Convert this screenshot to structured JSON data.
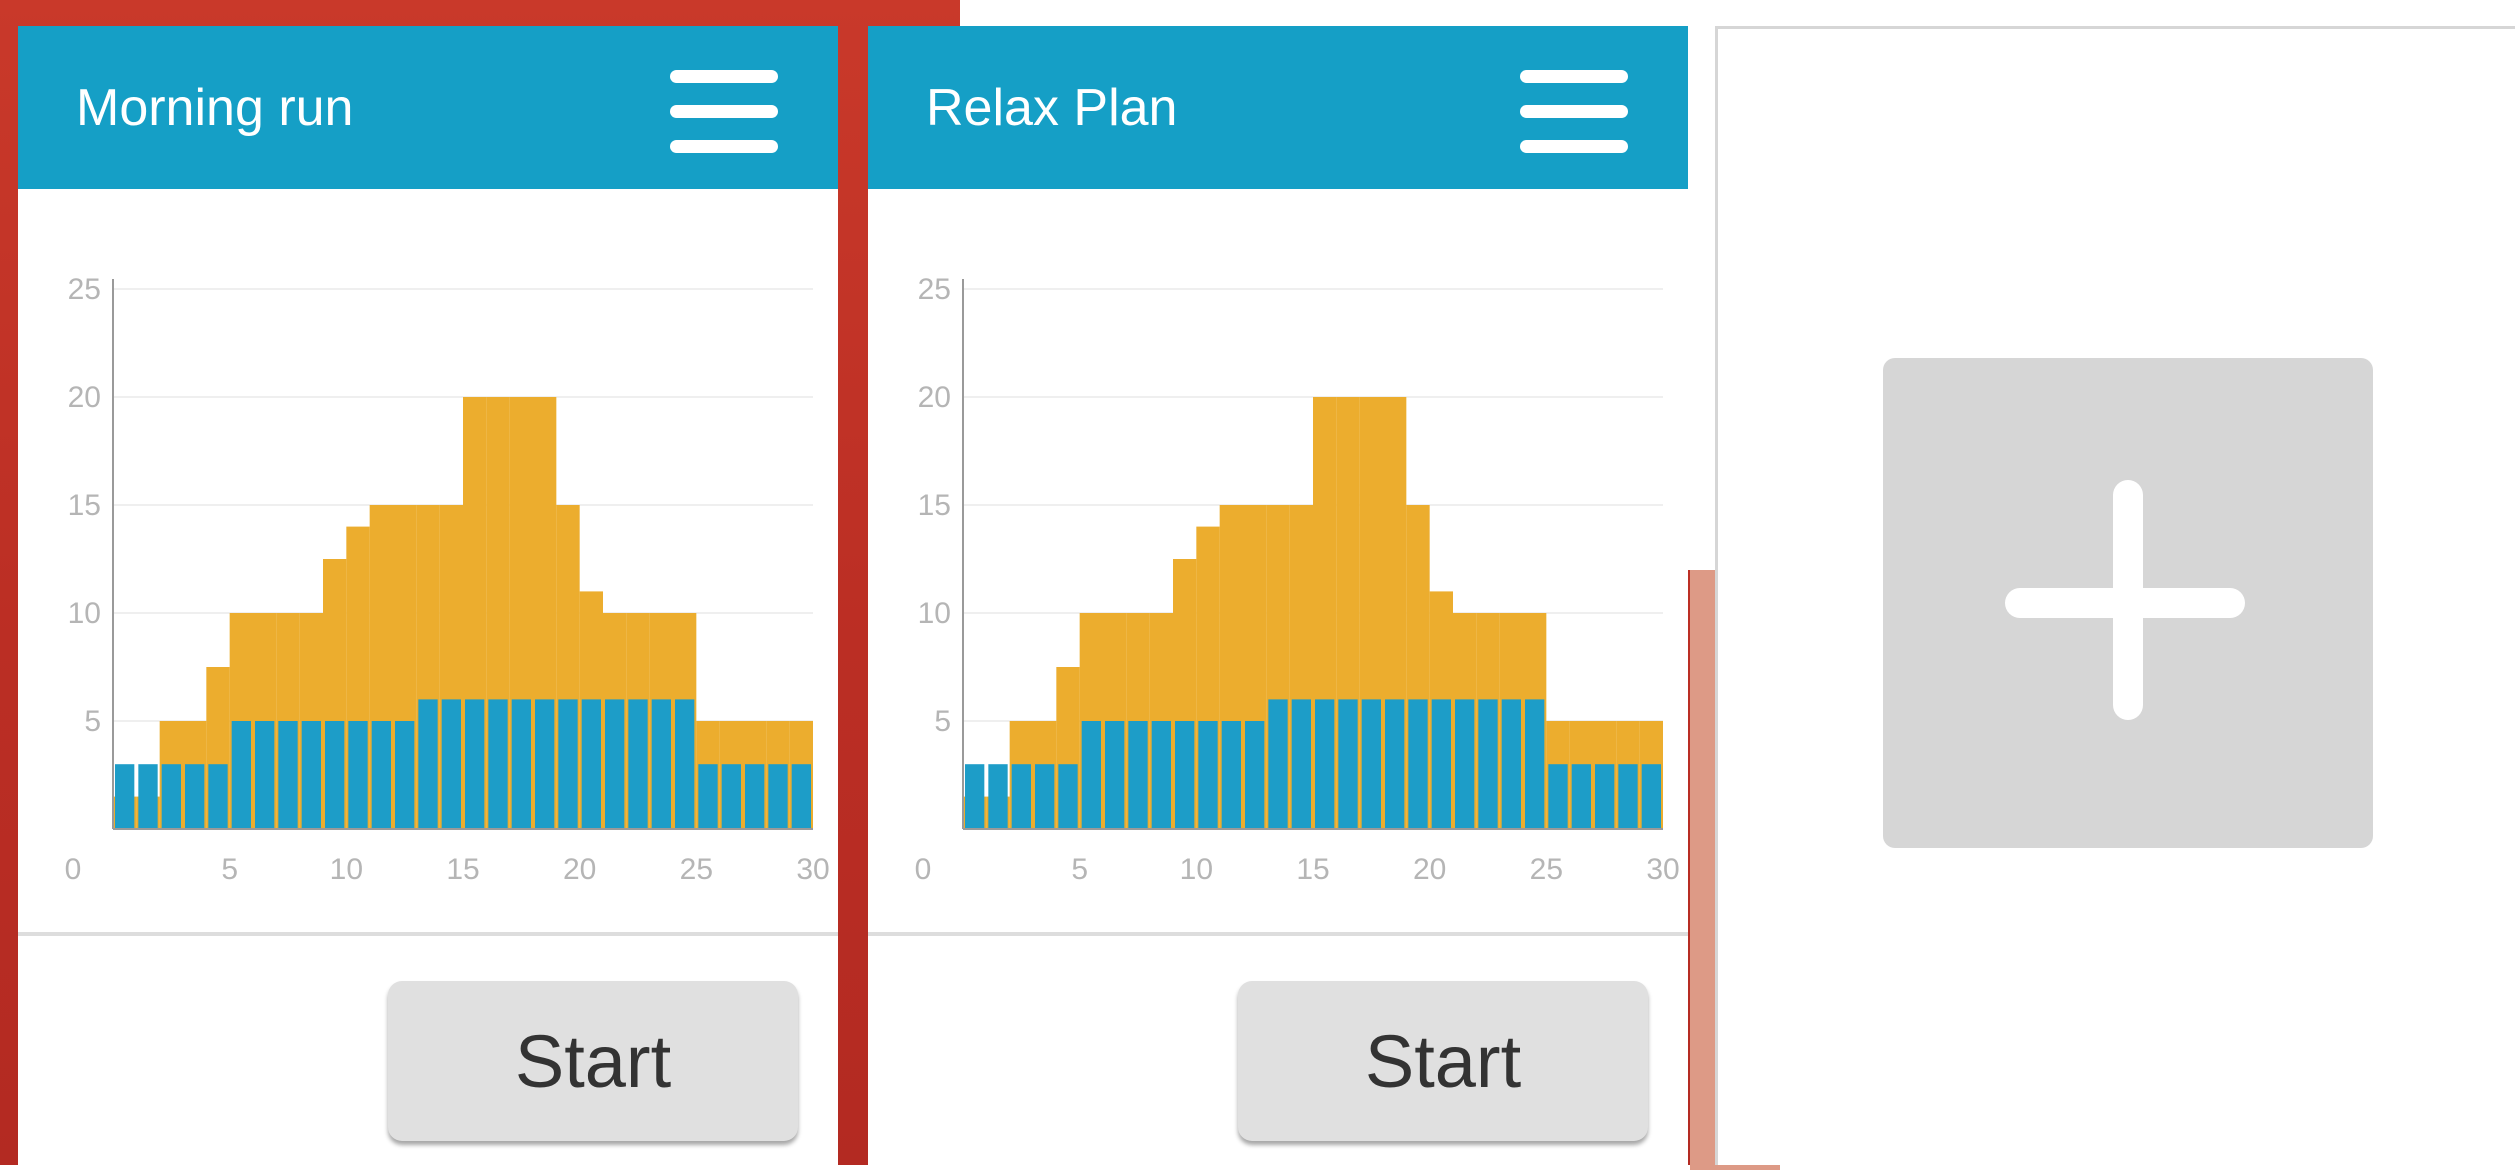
{
  "plans": [
    {
      "title": "Morning run",
      "start_label": "Start"
    },
    {
      "title": "Relax Plan",
      "start_label": "Start"
    }
  ],
  "chart_data": [
    {
      "type": "bar",
      "x_ticks": [
        "0",
        "5",
        "10",
        "15",
        "20",
        "25",
        "30"
      ],
      "y_ticks": [
        "5",
        "10",
        "15",
        "20",
        "25"
      ],
      "xlim": [
        0,
        30
      ],
      "ylim": [
        0,
        25
      ],
      "grid": true,
      "series": [
        {
          "color": "#ecad2e",
          "values": [
            1.5,
            1.5,
            5,
            5,
            7.5,
            10,
            10,
            10,
            10,
            12.5,
            14,
            15,
            15,
            15,
            15,
            20,
            20,
            20,
            20,
            15,
            11,
            10,
            10,
            10,
            10,
            5,
            5,
            5,
            5,
            5
          ]
        },
        {
          "color": "#1d9dc8",
          "values": [
            3,
            3,
            3,
            3,
            3,
            5,
            5,
            5,
            5,
            5,
            5,
            5,
            5,
            6,
            6,
            6,
            6,
            6,
            6,
            6,
            6,
            6,
            6,
            6,
            6,
            3,
            3,
            3,
            3,
            3
          ]
        }
      ]
    },
    {
      "type": "bar",
      "x_ticks": [
        "0",
        "5",
        "10",
        "15",
        "20",
        "25",
        "30"
      ],
      "y_ticks": [
        "5",
        "10",
        "15",
        "20",
        "25"
      ],
      "xlim": [
        0,
        30
      ],
      "ylim": [
        0,
        25
      ],
      "grid": true,
      "series": [
        {
          "color": "#ecad2e",
          "values": [
            1.5,
            1.5,
            5,
            5,
            7.5,
            10,
            10,
            10,
            10,
            12.5,
            14,
            15,
            15,
            15,
            15,
            20,
            20,
            20,
            20,
            15,
            11,
            10,
            10,
            10,
            10,
            5,
            5,
            5,
            5,
            5
          ]
        },
        {
          "color": "#1d9dc8",
          "values": [
            3,
            3,
            3,
            3,
            3,
            5,
            5,
            5,
            5,
            5,
            5,
            5,
            5,
            6,
            6,
            6,
            6,
            6,
            6,
            6,
            6,
            6,
            6,
            6,
            6,
            3,
            3,
            3,
            3,
            3
          ]
        }
      ]
    }
  ],
  "icons": {
    "menu": "menu-icon",
    "add": "plus-icon"
  },
  "colors": {
    "header": "#159fc6",
    "background_red": "#c9392a",
    "bar_orange": "#ecad2e",
    "bar_blue": "#1d9dc8"
  }
}
